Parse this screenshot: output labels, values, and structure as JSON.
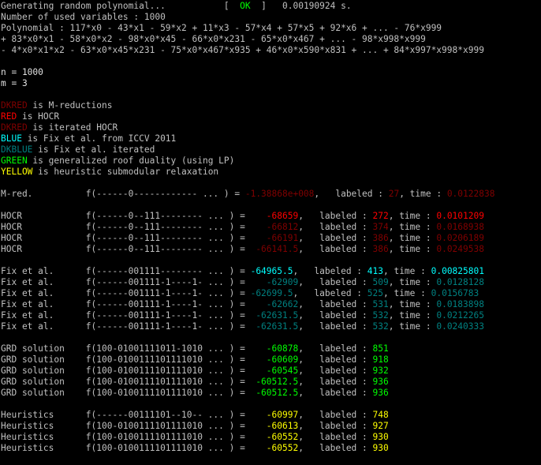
{
  "colors": {
    "gray": "#c0c0c0",
    "dkred": "#800000",
    "red": "#ff0000",
    "blue": "#00ffff",
    "dkblue": "#008080",
    "green": "#00ff00",
    "yellow": "#ffff00"
  },
  "lines": [
    [
      [
        "Generating random polynomial...           [  ",
        "gray"
      ],
      [
        "OK",
        "ok"
      ],
      [
        "  ]   0.00190924 s.",
        "gray"
      ]
    ],
    [
      [
        "Number of used variables : 1000",
        "gray"
      ]
    ],
    [
      [
        "Polynomial : 117*x0 - 43*x1 - 59*x2 + 11*x3 - 57*x4 + 57*x5 + 92*x6 + ... - 76*x999",
        "gray"
      ]
    ],
    [
      [
        "+ 83*x0*x1 - 58*x0*x2 - 98*x0*x45 - 66*x0*x231 - 65*x0*x467 + ... - 98*x998*x999",
        "gray"
      ]
    ],
    [
      [
        "- 4*x0*x1*x2 - 63*x0*x45*x231 - 75*x0*x467*x935 + 46*x0*x590*x831 + ... + 84*x997*x998*x999",
        "gray"
      ]
    ],
    [],
    [
      [
        "n = 1000",
        "white"
      ]
    ],
    [
      [
        "m = 3",
        "white"
      ]
    ],
    [],
    [
      [
        "DKRED",
        "dkred"
      ],
      [
        " is M-reductions",
        "gray"
      ]
    ],
    [
      [
        "RED",
        "red"
      ],
      [
        " is HOCR",
        "gray"
      ]
    ],
    [
      [
        "DKRED",
        "dkred"
      ],
      [
        " is iterated HOCR",
        "gray"
      ]
    ],
    [
      [
        "BLUE",
        "blue"
      ],
      [
        " is Fix et al. from ICCV 2011",
        "gray"
      ]
    ],
    [
      [
        "DKBLUE",
        "dkblue"
      ],
      [
        " is Fix et al. iterated",
        "gray"
      ]
    ],
    [
      [
        "GREEN",
        "green"
      ],
      [
        " is generalized roof duality (using LP)",
        "gray"
      ]
    ],
    [
      [
        "YELLOW",
        "yellow"
      ],
      [
        " is heuristic submodular relaxation",
        "gray"
      ]
    ],
    [],
    [
      [
        "M-red.          f(------0------------ ... ) = ",
        "gray"
      ],
      [
        "-1.38868e+008",
        "dkred"
      ],
      [
        ",   labeled : ",
        "gray"
      ],
      [
        "27",
        "dkred"
      ],
      [
        ", time : ",
        "gray"
      ],
      [
        "0.0122838",
        "dkred"
      ]
    ],
    [],
    [
      [
        "HOCR            f(------0--111-------- ... ) =    ",
        "gray"
      ],
      [
        "-68659",
        "red"
      ],
      [
        ",   labeled : ",
        "gray"
      ],
      [
        "272",
        "red"
      ],
      [
        ", time : ",
        "gray"
      ],
      [
        "0.0101209",
        "red"
      ]
    ],
    [
      [
        "HOCR            f(------0--111-------- ... ) =    ",
        "gray"
      ],
      [
        "-66812",
        "dkred"
      ],
      [
        ",   labeled : ",
        "gray"
      ],
      [
        "374",
        "dkred"
      ],
      [
        ", time : ",
        "gray"
      ],
      [
        "0.0168938",
        "dkred"
      ]
    ],
    [
      [
        "HOCR            f(------0--111-------- ... ) =    ",
        "gray"
      ],
      [
        "-66191",
        "dkred"
      ],
      [
        ",   labeled : ",
        "gray"
      ],
      [
        "386",
        "dkred"
      ],
      [
        ", time : ",
        "gray"
      ],
      [
        "0.0206189",
        "dkred"
      ]
    ],
    [
      [
        "HOCR            f(------0--111-------- ... ) =  ",
        "gray"
      ],
      [
        "-66141.5",
        "dkred"
      ],
      [
        ",   labeled : ",
        "gray"
      ],
      [
        "386",
        "dkred"
      ],
      [
        ", time : ",
        "gray"
      ],
      [
        "0.0249538",
        "dkred"
      ]
    ],
    [],
    [
      [
        "Fix et al.      f(------001111-------- ... ) = ",
        "gray"
      ],
      [
        "-64965.5",
        "blue"
      ],
      [
        ",   labeled : ",
        "gray"
      ],
      [
        "413",
        "blue"
      ],
      [
        ", time : ",
        "gray"
      ],
      [
        "0.00825801",
        "blue"
      ]
    ],
    [
      [
        "Fix et al.      f(------001111-1----1- ... ) =    ",
        "gray"
      ],
      [
        "-62909",
        "dkblue"
      ],
      [
        ",   labeled : ",
        "gray"
      ],
      [
        "509",
        "dkblue"
      ],
      [
        ", time : ",
        "gray"
      ],
      [
        "0.0128128",
        "dkblue"
      ]
    ],
    [
      [
        "Fix et al.      f(------001111-1----1- ... ) = ",
        "gray"
      ],
      [
        "-62699.5",
        "dkblue"
      ],
      [
        ",   labeled : ",
        "gray"
      ],
      [
        "525",
        "dkblue"
      ],
      [
        ", time : ",
        "gray"
      ],
      [
        "0.0156783",
        "dkblue"
      ]
    ],
    [
      [
        "Fix et al.      f(------001111-1----1- ... ) =    ",
        "gray"
      ],
      [
        "-62662",
        "dkblue"
      ],
      [
        ",   labeled : ",
        "gray"
      ],
      [
        "531",
        "dkblue"
      ],
      [
        ", time : ",
        "gray"
      ],
      [
        "0.0183898",
        "dkblue"
      ]
    ],
    [
      [
        "Fix et al.      f(------001111-1----1- ... ) =  ",
        "gray"
      ],
      [
        "-62631.5",
        "dkblue"
      ],
      [
        ",   labeled : ",
        "gray"
      ],
      [
        "532",
        "dkblue"
      ],
      [
        ", time : ",
        "gray"
      ],
      [
        "0.0212265",
        "dkblue"
      ]
    ],
    [
      [
        "Fix et al.      f(------001111-1----1- ... ) =  ",
        "gray"
      ],
      [
        "-62631.5",
        "dkblue"
      ],
      [
        ",   labeled : ",
        "gray"
      ],
      [
        "532",
        "dkblue"
      ],
      [
        ", time : ",
        "gray"
      ],
      [
        "0.0240333",
        "dkblue"
      ]
    ],
    [],
    [
      [
        "GRD solution    f(100-01001111011-1010 ... ) =    ",
        "gray"
      ],
      [
        "-60878",
        "green"
      ],
      [
        ",   labeled : ",
        "gray"
      ],
      [
        "851",
        "green"
      ]
    ],
    [
      [
        "GRD solution    f(100-0100111101111010 ... ) =    ",
        "gray"
      ],
      [
        "-60609",
        "green"
      ],
      [
        ",   labeled : ",
        "gray"
      ],
      [
        "918",
        "green"
      ]
    ],
    [
      [
        "GRD solution    f(100-0100111101111010 ... ) =    ",
        "gray"
      ],
      [
        "-60545",
        "green"
      ],
      [
        ",   labeled : ",
        "gray"
      ],
      [
        "932",
        "green"
      ]
    ],
    [
      [
        "GRD solution    f(100-0100111101111010 ... ) =  ",
        "gray"
      ],
      [
        "-60512.5",
        "green"
      ],
      [
        ",   labeled : ",
        "gray"
      ],
      [
        "936",
        "green"
      ]
    ],
    [
      [
        "GRD solution    f(100-0100111101111010 ... ) =  ",
        "gray"
      ],
      [
        "-60512.5",
        "green"
      ],
      [
        ",   labeled : ",
        "gray"
      ],
      [
        "936",
        "green"
      ]
    ],
    [],
    [
      [
        "Heuristics      f(------00111101--10-- ... ) =    ",
        "gray"
      ],
      [
        "-60997",
        "yellow"
      ],
      [
        ",   labeled : ",
        "gray"
      ],
      [
        "748",
        "yellow"
      ]
    ],
    [
      [
        "Heuristics      f(100-0100111101111010 ... ) =    ",
        "gray"
      ],
      [
        "-60613",
        "yellow"
      ],
      [
        ",   labeled : ",
        "gray"
      ],
      [
        "927",
        "yellow"
      ]
    ],
    [
      [
        "Heuristics      f(100-0100111101111010 ... ) =    ",
        "gray"
      ],
      [
        "-60552",
        "yellow"
      ],
      [
        ",   labeled : ",
        "gray"
      ],
      [
        "930",
        "yellow"
      ]
    ],
    [
      [
        "Heuristics      f(100-0100111101111010 ... ) =    ",
        "gray"
      ],
      [
        "-60552",
        "yellow"
      ],
      [
        ",   labeled : ",
        "gray"
      ],
      [
        "930",
        "yellow"
      ]
    ]
  ]
}
